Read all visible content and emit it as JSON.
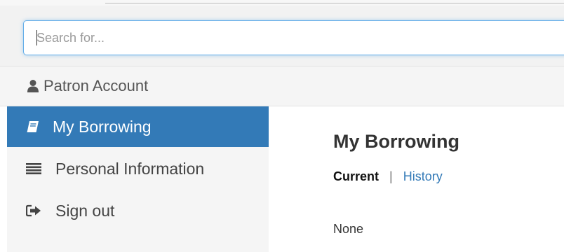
{
  "search": {
    "placeholder": "Search for..."
  },
  "account": {
    "title": "Patron Account"
  },
  "sidebar": {
    "items": [
      {
        "label": "My Borrowing",
        "icon": "book-icon",
        "active": true
      },
      {
        "label": "Personal Information",
        "icon": "list-icon",
        "active": false
      },
      {
        "label": "Sign out",
        "icon": "sign-out-icon",
        "active": false
      }
    ]
  },
  "main": {
    "title": "My Borrowing",
    "tabs": [
      {
        "label": "Current",
        "active": true
      },
      {
        "label": "History",
        "active": false
      }
    ],
    "separator": "|",
    "empty_text": "None"
  },
  "colors": {
    "accent": "#337ab7",
    "focus_border": "#66afe9",
    "panel_bg": "#f5f5f5"
  }
}
